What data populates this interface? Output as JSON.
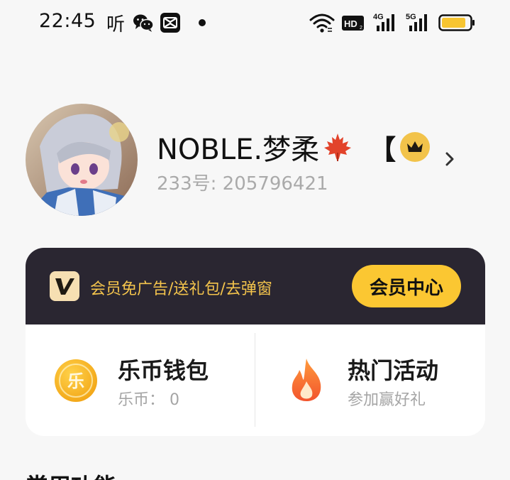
{
  "status_bar": {
    "time": "22:45",
    "ting_glyph": "听",
    "icons": [
      "ting-app-icon",
      "wechat-icon",
      "capcut-icon",
      "dot-icon",
      "wifi-icon",
      "hd-icon",
      "signal-4g-icon",
      "signal-5g-icon",
      "battery-icon"
    ],
    "hd_label": "HD",
    "sig1_label": "4G",
    "sig2_label": "5G",
    "battery_color": "#f7c531"
  },
  "profile": {
    "username": "NOBLE.梦柔",
    "bracket": "【",
    "uid": "233号: 205796421"
  },
  "vip": {
    "logo": "V",
    "promo_text": "会员免广告/送礼包/去弹窗",
    "button_label": "会员中心",
    "accent": "#fbc732",
    "bar_color": "#2a2631"
  },
  "wallet": {
    "coin_glyph": "乐",
    "title": "乐币钱包",
    "subtitle": "乐币：  0"
  },
  "activity": {
    "title": "热门活动",
    "subtitle": "参加赢好礼"
  },
  "section": {
    "title": "常用功能"
  }
}
